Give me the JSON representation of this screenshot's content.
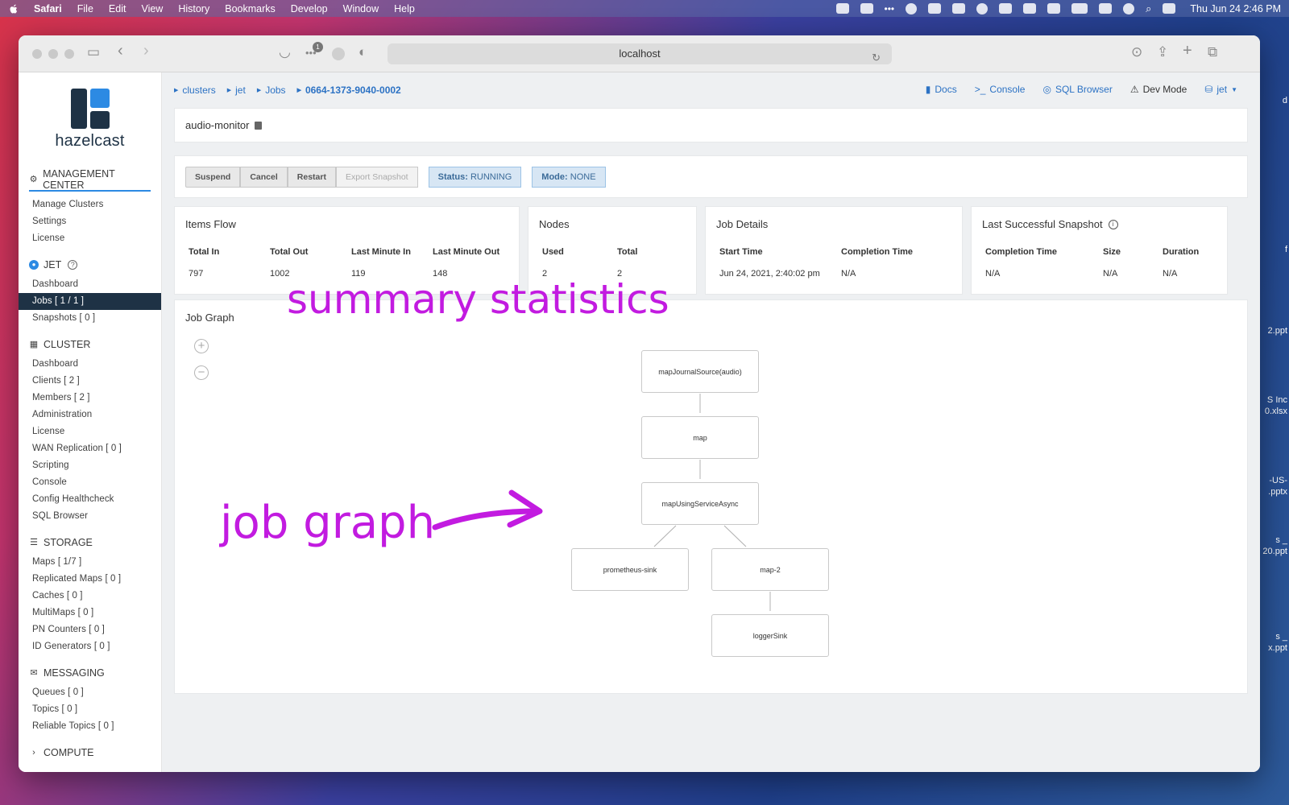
{
  "menubar": {
    "items": [
      "Safari",
      "File",
      "Edit",
      "View",
      "History",
      "Bookmarks",
      "Develop",
      "Window",
      "Help"
    ],
    "clock": "Thu Jun 24  2:46 PM"
  },
  "desktop": {
    "files": [
      "d",
      "f",
      "2.ppt",
      "S Inc\n0.xlsx",
      "-US-\n.pptx",
      "s _\n20.ppt",
      "s _\nx.ppt"
    ]
  },
  "browser": {
    "url": "localhost",
    "extension_badge": "1"
  },
  "sidebar": {
    "brand": "hazelcast",
    "management_center": {
      "title": "MANAGEMENT CENTER",
      "items": [
        "Manage Clusters",
        "Settings",
        "License"
      ]
    },
    "jet": {
      "title": "JET",
      "items": [
        "Dashboard",
        "Jobs [ 1 / 1 ]",
        "Snapshots [ 0 ]"
      ]
    },
    "cluster": {
      "title": "CLUSTER",
      "items": [
        "Dashboard",
        "Clients [ 2 ]",
        "Members [ 2 ]",
        "Administration",
        "License",
        "WAN Replication [ 0 ]",
        "Scripting",
        "Console",
        "Config Healthcheck",
        "SQL Browser"
      ]
    },
    "storage": {
      "title": "STORAGE",
      "items": [
        "Maps [ 1/7 ]",
        "Replicated Maps [ 0 ]",
        "Caches [ 0 ]",
        "MultiMaps [ 0 ]",
        "PN Counters [ 0 ]",
        "ID Generators [ 0 ]"
      ]
    },
    "messaging": {
      "title": "MESSAGING",
      "items": [
        "Queues [ 0 ]",
        "Topics [ 0 ]",
        "Reliable Topics [ 0 ]"
      ]
    },
    "compute": {
      "title": "COMPUTE"
    }
  },
  "breadcrumbs": [
    "clusters",
    "jet",
    "Jobs",
    "0664-1373-9040-0002"
  ],
  "topnav": {
    "docs": "Docs",
    "console": "Console",
    "sql_browser": "SQL Browser",
    "dev_mode": "Dev Mode",
    "cluster": "jet"
  },
  "job": {
    "name": "audio-monitor",
    "actions": {
      "suspend": "Suspend",
      "cancel": "Cancel",
      "restart": "Restart",
      "export_snapshot": "Export Snapshot"
    },
    "status_label": "Status:",
    "status_value": "RUNNING",
    "mode_label": "Mode:",
    "mode_value": "NONE"
  },
  "items_flow": {
    "title": "Items Flow",
    "headers": [
      "Total In",
      "Total Out",
      "Last Minute In",
      "Last Minute Out"
    ],
    "values": [
      "797",
      "1002",
      "119",
      "148"
    ]
  },
  "nodes": {
    "title": "Nodes",
    "headers": [
      "Used",
      "Total"
    ],
    "values": [
      "2",
      "2"
    ]
  },
  "job_details": {
    "title": "Job Details",
    "headers": [
      "Start Time",
      "Completion Time"
    ],
    "values": [
      "Jun 24, 2021, 2:40:02 pm",
      "N/A"
    ]
  },
  "last_snapshot": {
    "title": "Last Successful Snapshot",
    "headers": [
      "Completion Time",
      "Size",
      "Duration"
    ],
    "values": [
      "N/A",
      "N/A",
      "N/A"
    ]
  },
  "job_graph": {
    "title": "Job Graph",
    "nodes": [
      "mapJournalSource(audio)",
      "map",
      "mapUsingServiceAsync",
      "prometheus-sink",
      "map-2",
      "loggerSink"
    ]
  },
  "annotations": {
    "summary": "summary statistics",
    "graph": "job graph",
    "color": "#c21be0"
  }
}
